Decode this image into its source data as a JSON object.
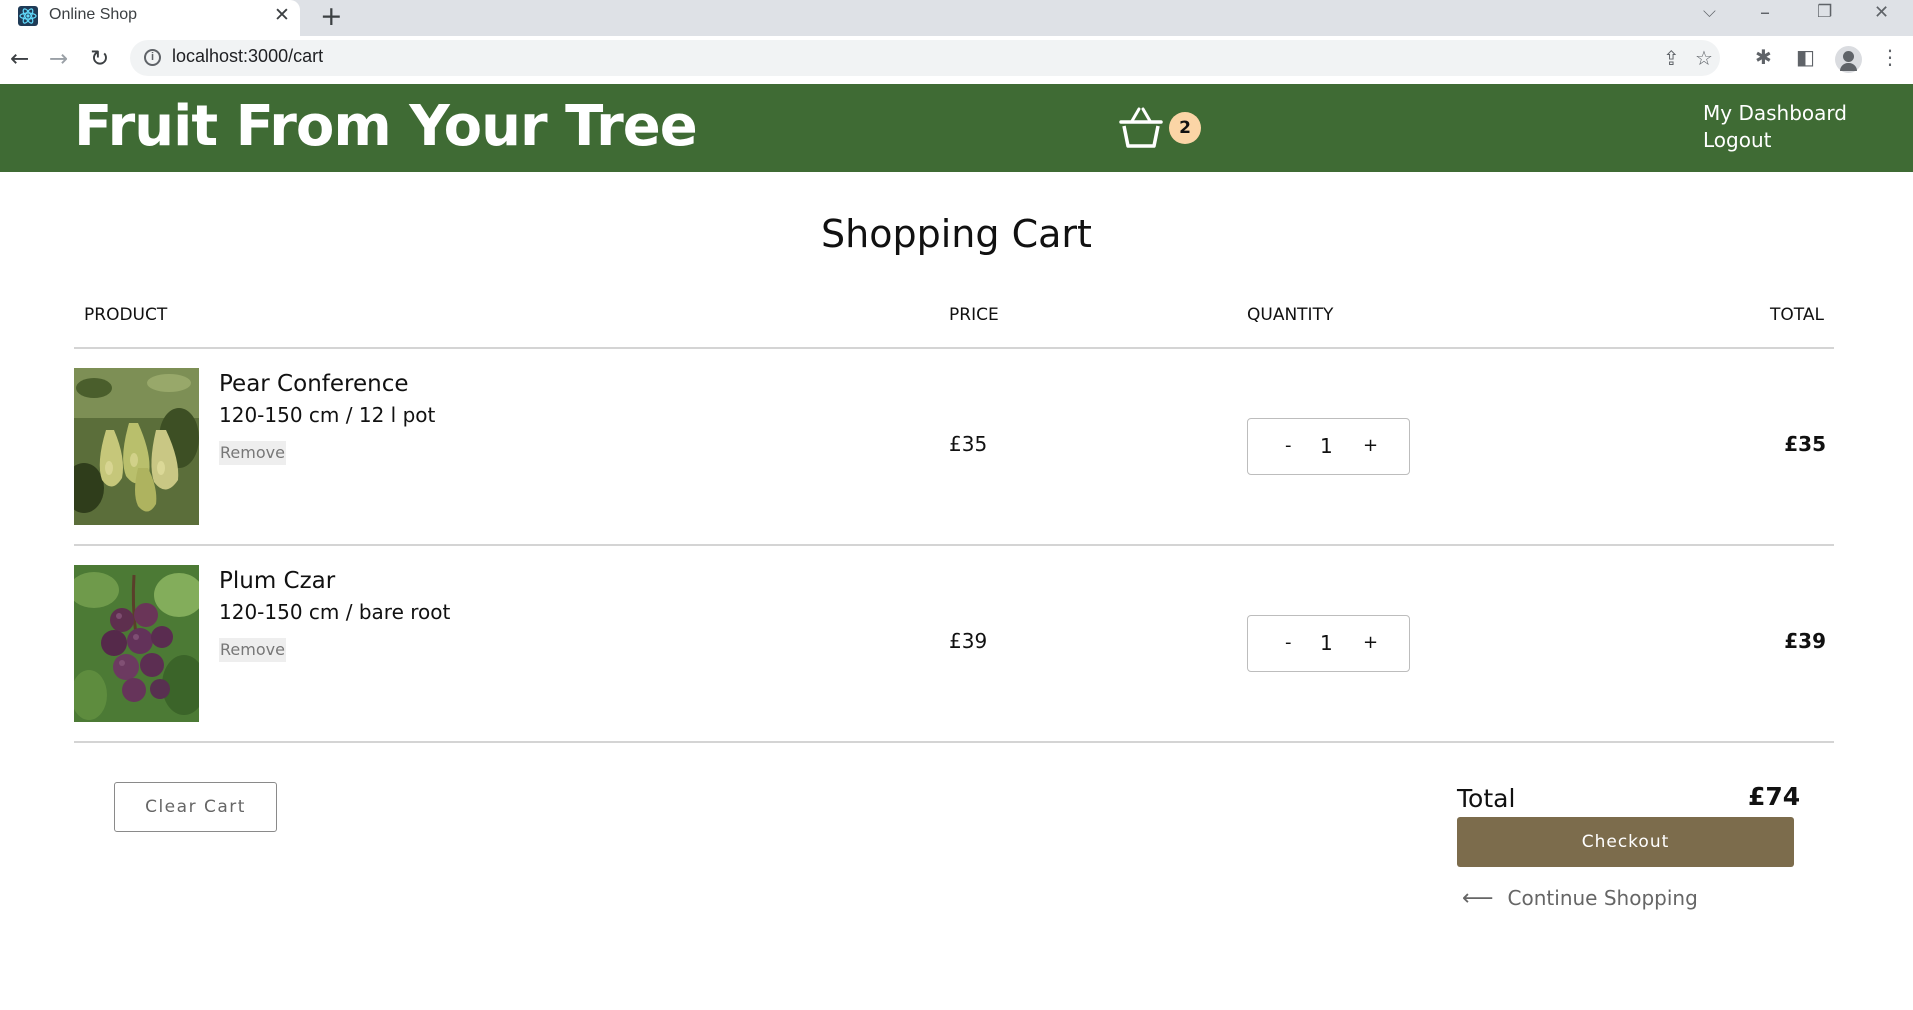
{
  "browser": {
    "tab_title": "Online Shop",
    "tab_close": "✕",
    "new_tab": "+",
    "url": "localhost:3000/cart",
    "controls": {
      "collapse": "⌵",
      "minimize": "–",
      "restore": "❐",
      "close": "✕"
    },
    "nav": {
      "back": "←",
      "forward": "→",
      "reload": "↻"
    }
  },
  "header": {
    "brand": "Fruit From Your Tree",
    "cart_count": "2",
    "links": [
      "My Dashboard",
      "Logout"
    ]
  },
  "cart": {
    "title": "Shopping Cart",
    "columns": {
      "product": "PRODUCT",
      "price": "PRICE",
      "quantity": "QUANTITY",
      "total": "TOTAL"
    },
    "items": [
      {
        "name": "Pear Conference",
        "variant": "120-150 cm / 12 l pot",
        "remove_label": "Remove",
        "price": "£35",
        "quantity": "1",
        "total": "£35",
        "minus": "-",
        "plus": "+"
      },
      {
        "name": "Plum Czar",
        "variant": "120-150 cm / bare root",
        "remove_label": "Remove",
        "price": "£39",
        "quantity": "1",
        "total": "£39",
        "minus": "-",
        "plus": "+"
      }
    ],
    "clear_label": "Clear Cart",
    "summary": {
      "label": "Total",
      "value": "£74"
    },
    "checkout_label": "Checkout",
    "continue_label": "Continue Shopping",
    "continue_arrow": "⟵"
  },
  "colors": {
    "header_bg": "#3f6b34",
    "checkout_bg": "#7c6c4c",
    "badge_bg": "#fbd5a6"
  }
}
